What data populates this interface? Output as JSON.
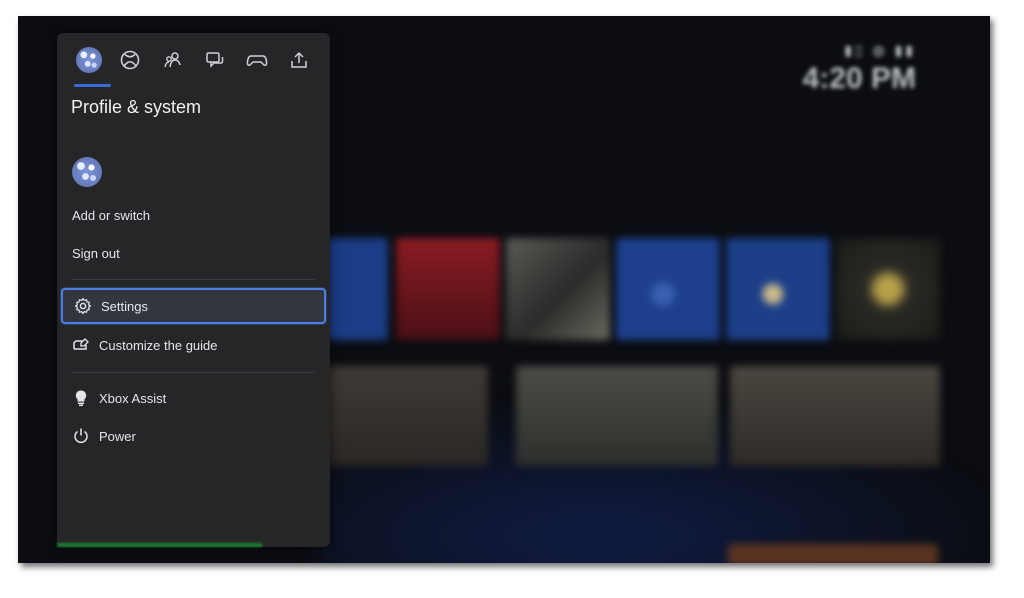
{
  "colors": {
    "accent": "#3b6bd6",
    "selection_border": "#4c7ee8",
    "panel": "#262629"
  },
  "guide": {
    "tabs": [
      {
        "name": "profile-avatar-tab",
        "icon": "avatar-icon"
      },
      {
        "name": "xbox-tab",
        "icon": "xbox-icon"
      },
      {
        "name": "people-tab",
        "icon": "people-icon"
      },
      {
        "name": "chat-tab",
        "icon": "chat-icon"
      },
      {
        "name": "controller-tab",
        "icon": "controller-icon"
      },
      {
        "name": "share-tab",
        "icon": "share-icon"
      }
    ],
    "active_tab": "profile-avatar-tab",
    "title": "Profile & system",
    "add_or_switch": "Add or switch",
    "sign_out": "Sign out",
    "settings": "Settings",
    "customize": "Customize the guide",
    "xbox_assist": "Xbox Assist",
    "power": "Power"
  },
  "background": {
    "status_icons": "▮▯ ◍ ▮▮",
    "time": "4:20 PM"
  }
}
